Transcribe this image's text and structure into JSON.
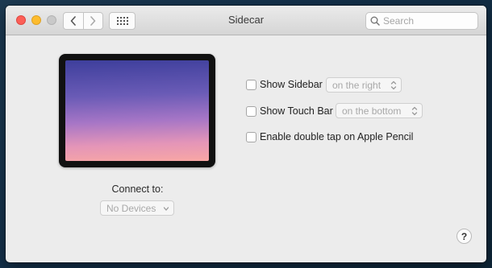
{
  "window": {
    "title": "Sidecar",
    "search": {
      "placeholder": "Search"
    }
  },
  "device": {
    "connect_label": "Connect to:",
    "connect_value": "No Devices"
  },
  "options": [
    {
      "label": "Show Sidebar",
      "checked": false,
      "popup": "on the right"
    },
    {
      "label": "Show Touch Bar",
      "checked": false,
      "popup": "on the bottom"
    },
    {
      "label": "Enable double tap on Apple Pencil",
      "checked": false
    }
  ],
  "help": {
    "label": "?"
  },
  "icons": {
    "close": "close-icon",
    "minimize": "minimize-icon",
    "zoom": "zoom-icon",
    "back": "chevron-left-icon",
    "forward": "chevron-right-icon",
    "show_all": "grid-icon",
    "search": "search-icon",
    "popup_arrows": "up-down-chevron-icon"
  },
  "colors": {
    "close": "#fc5f57",
    "minimize": "#fdbc2e",
    "zoom_inactive": "#c9c9c9",
    "window_bg": "#ececec"
  }
}
